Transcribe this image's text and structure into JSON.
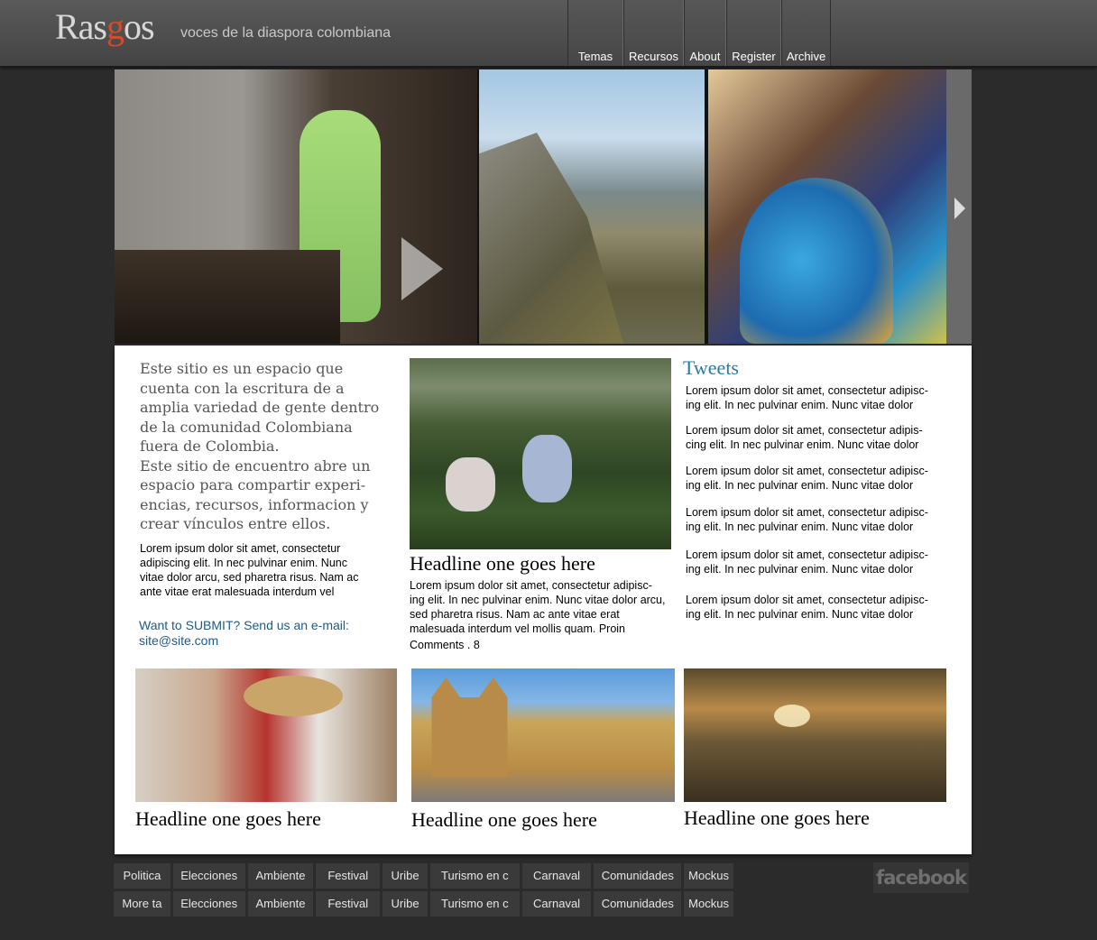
{
  "header": {
    "logo_text_1": "Ras",
    "logo_text_2": "g",
    "logo_text_3": "os",
    "tagline": "voces de la diaspora colombiana",
    "nav": [
      "Temas",
      "Recursos",
      "About",
      "Register",
      "Archive"
    ]
  },
  "intro": {
    "para1": "Este sitio es un espacio que cuenta con la escritura de a amplia variedad de gente dentro de la comunidad Colombiana fuera de Colombia.",
    "para2": "Este sitio de encuentro abre un espacio para compartir experi-encias, recursos, informacion y crear vínculos entre ellos.",
    "lorem": "Lorem ipsum dolor sit amet, consectetur adipiscing elit. In nec pulvinar enim. Nunc vitae dolor arcu, sed pharetra risus. Nam ac ante vitae erat malesuada interdum vel",
    "submit_line1": "Want to SUBMIT? Send us an e-mail:",
    "submit_line2": "site@site.com"
  },
  "feature": {
    "headline": "Headline one goes here",
    "text": "Lorem ipsum dolor sit amet, consectetur adipisc-ing elit. In nec pulvinar enim. Nunc vitae dolor arcu, sed pharetra risus. Nam ac ante vitae erat malesuada interdum vel mollis quam. Proin",
    "comments": "Comments . 8"
  },
  "tweets": {
    "title": "Tweets",
    "items": [
      "Lorem ipsum dolor sit amet, consectetur adipisc-ing elit. In nec pulvinar enim. Nunc vitae dolor",
      "Lorem ipsum dolor sit amet, consectetur adipis-cing elit. In nec pulvinar enim. Nunc vitae dolor",
      "Lorem ipsum dolor sit amet, consectetur adipisc-ing elit. In nec pulvinar enim. Nunc vitae dolor",
      "Lorem ipsum dolor sit amet, consectetur adipisc-ing elit. In nec pulvinar enim. Nunc vitae dolor",
      "Lorem ipsum dolor sit amet, consectetur adipisc-ing elit. In nec pulvinar enim. Nunc vitae dolor",
      "Lorem ipsum dolor sit amet, consectetur adipisc-ing elit. In nec pulvinar enim. Nunc vitae dolor"
    ]
  },
  "thumbs": [
    {
      "headline": "Headline one goes here"
    },
    {
      "headline": "Headline one goes here"
    },
    {
      "headline": "Headline one goes here"
    }
  ],
  "tags": {
    "row1": [
      "Politica",
      "Elecciones",
      "Ambiente",
      "Festival",
      "Uribe",
      "Turismo en c",
      "Carnaval",
      "Comunidades",
      "Mockus"
    ],
    "row2": [
      "More ta",
      "Elecciones",
      "Ambiente",
      "Festival",
      "Uribe",
      "Turismo en c",
      "Carnaval",
      "Comunidades",
      "Mockus"
    ]
  },
  "social": {
    "facebook": "facebook"
  },
  "colors": {
    "accent_link": "#1f5a86",
    "tweets_title": "#2a7aa0",
    "logo_g": "#d84a2a"
  }
}
